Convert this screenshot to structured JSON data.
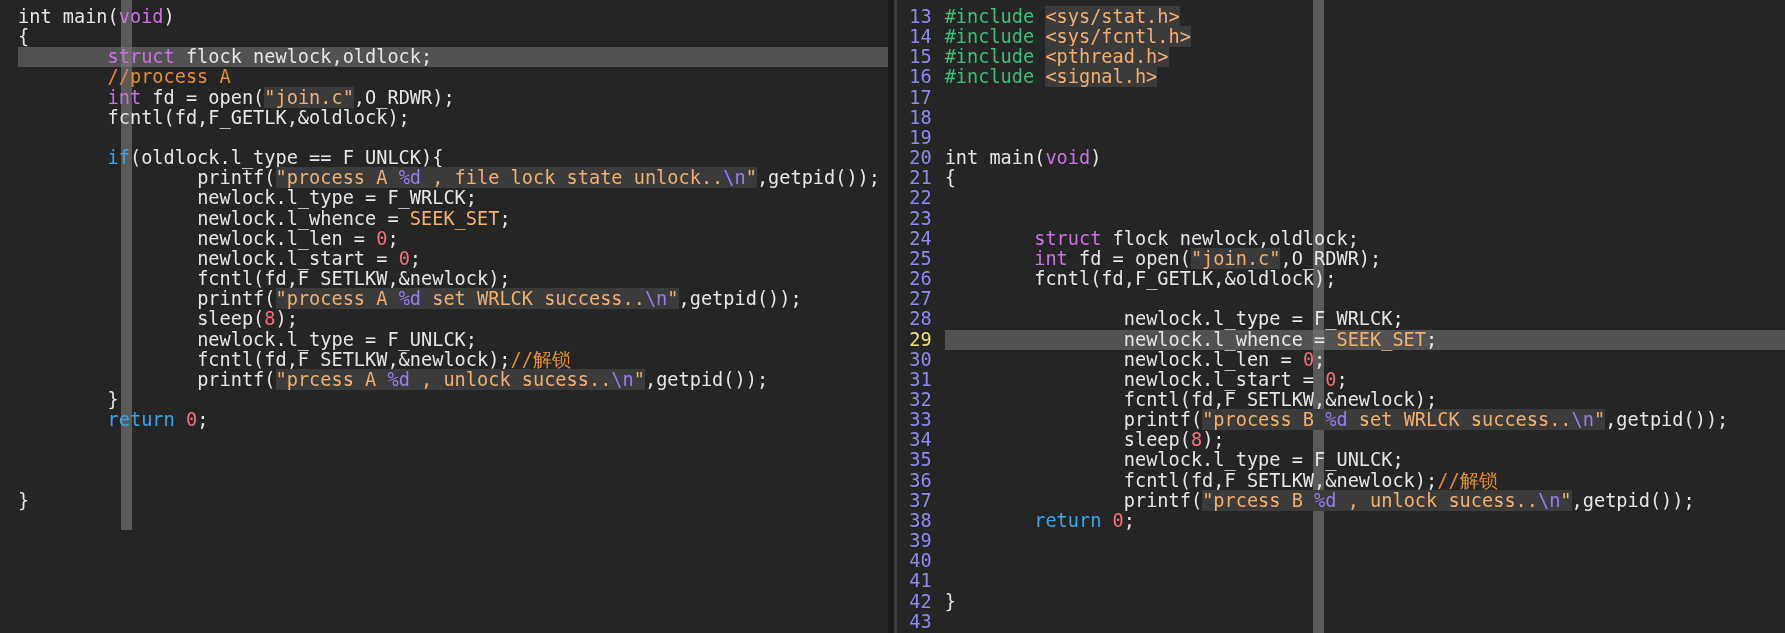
{
  "panes": [
    {
      "lines": [
        {
          "current": false,
          "tokens": [
            {
              "kind": "plain",
              "text": "int main("
            },
            {
              "kind": "type",
              "text": "void"
            },
            {
              "kind": "plain",
              "text": ")"
            }
          ]
        },
        {
          "current": false,
          "tokens": [
            {
              "kind": "plain",
              "text": "{"
            }
          ]
        },
        {
          "current": true,
          "tokens": [
            {
              "kind": "type",
              "text": "\tstruct"
            },
            {
              "kind": "plain",
              "text": " flock newlock,oldlock;"
            }
          ]
        },
        {
          "current": false,
          "tokens": [
            {
              "kind": "comment",
              "text": "\t//process A"
            }
          ]
        },
        {
          "current": false,
          "tokens": [
            {
              "kind": "type",
              "text": "\tint"
            },
            {
              "kind": "plain",
              "text": " fd = open("
            },
            {
              "kind": "string",
              "text": "\"join.c\""
            },
            {
              "kind": "plain",
              "text": ",O_RDWR);"
            }
          ]
        },
        {
          "current": false,
          "tokens": [
            {
              "kind": "plain",
              "text": "\tfcntl(fd,F_GETLK,&oldlock);"
            }
          ]
        },
        {
          "current": false
        },
        {
          "current": false,
          "tokens": [
            {
              "kind": "control",
              "text": "\tif"
            },
            {
              "kind": "plain",
              "text": "(oldlock.l_type == F_UNLCK){"
            }
          ]
        },
        {
          "current": false,
          "tokens": [
            {
              "kind": "plain",
              "text": "\t\tprintf("
            },
            {
              "kind": "string",
              "text": "\"process A "
            },
            {
              "kind": "format",
              "text": "%d"
            },
            {
              "kind": "string",
              "text": " , file lock state unlock.."
            },
            {
              "kind": "format",
              "text": "\\n"
            },
            {
              "kind": "string",
              "text": "\""
            },
            {
              "kind": "plain",
              "text": ",getpid());"
            }
          ]
        },
        {
          "current": false,
          "tokens": [
            {
              "kind": "plain",
              "text": "\t\tnewlock.l_type = F_WRLCK;"
            }
          ]
        },
        {
          "current": false,
          "tokens": [
            {
              "kind": "plain",
              "text": "\t\tnewlock.l_whence = "
            },
            {
              "kind": "constant",
              "text": "SEEK_SET"
            },
            {
              "kind": "plain",
              "text": ";"
            }
          ]
        },
        {
          "current": false,
          "tokens": [
            {
              "kind": "plain",
              "text": "\t\tnewlock.l_len = "
            },
            {
              "kind": "number",
              "text": "0"
            },
            {
              "kind": "plain",
              "text": ";"
            }
          ]
        },
        {
          "current": false,
          "tokens": [
            {
              "kind": "plain",
              "text": "\t\tnewlock.l_start = "
            },
            {
              "kind": "number",
              "text": "0"
            },
            {
              "kind": "plain",
              "text": ";"
            }
          ]
        },
        {
          "current": false,
          "tokens": [
            {
              "kind": "plain",
              "text": "\t\tfcntl(fd,F_SETLKW,&newlock);"
            }
          ]
        },
        {
          "current": false,
          "tokens": [
            {
              "kind": "plain",
              "text": "\t\tprintf("
            },
            {
              "kind": "string",
              "text": "\"process A "
            },
            {
              "kind": "format",
              "text": "%d"
            },
            {
              "kind": "string",
              "text": " set WRLCK success.."
            },
            {
              "kind": "format",
              "text": "\\n"
            },
            {
              "kind": "string",
              "text": "\""
            },
            {
              "kind": "plain",
              "text": ",getpid());"
            }
          ]
        },
        {
          "current": false,
          "tokens": [
            {
              "kind": "plain",
              "text": "\t\tsleep("
            },
            {
              "kind": "number",
              "text": "8"
            },
            {
              "kind": "plain",
              "text": ");"
            }
          ]
        },
        {
          "current": false,
          "tokens": [
            {
              "kind": "plain",
              "text": "\t\tnewlock.l_type = F_UNLCK;"
            }
          ]
        },
        {
          "current": false,
          "tokens": [
            {
              "kind": "plain",
              "text": "\t\tfcntl(fd,F_SETLKW,&newlock);"
            },
            {
              "kind": "comment",
              "text": "//解锁"
            }
          ]
        },
        {
          "current": false,
          "tokens": [
            {
              "kind": "plain",
              "text": "\t\tprintf("
            },
            {
              "kind": "string",
              "text": "\"prcess A "
            },
            {
              "kind": "format",
              "text": "%d"
            },
            {
              "kind": "string",
              "text": " , unlock sucess.."
            },
            {
              "kind": "format",
              "text": "\\n"
            },
            {
              "kind": "string",
              "text": "\""
            },
            {
              "kind": "plain",
              "text": ",getpid());"
            }
          ]
        },
        {
          "current": false,
          "tokens": [
            {
              "kind": "plain",
              "text": "\t}"
            }
          ]
        },
        {
          "current": false,
          "tokens": [
            {
              "kind": "control",
              "text": "\treturn"
            },
            {
              "kind": "number",
              "text": " 0"
            },
            {
              "kind": "plain",
              "text": ";"
            }
          ]
        },
        {
          "current": false
        },
        {
          "current": false
        },
        {
          "current": false
        },
        {
          "current": false,
          "tokens": [
            {
              "kind": "plain",
              "text": "}"
            }
          ]
        }
      ]
    },
    {
      "lines": [
        {
          "number": "13",
          "current": false,
          "tokens": [
            {
              "kind": "preproc",
              "text": "#include "
            },
            {
              "kind": "header",
              "text": "<sys/stat.h>"
            }
          ]
        },
        {
          "number": "14",
          "current": false,
          "tokens": [
            {
              "kind": "preproc",
              "text": "#include "
            },
            {
              "kind": "header",
              "text": "<sys/fcntl.h>"
            }
          ]
        },
        {
          "number": "15",
          "current": false,
          "tokens": [
            {
              "kind": "preproc",
              "text": "#include "
            },
            {
              "kind": "header",
              "text": "<pthread.h>"
            }
          ]
        },
        {
          "number": "16",
          "current": false,
          "tokens": [
            {
              "kind": "preproc",
              "text": "#include "
            },
            {
              "kind": "header",
              "text": "<signal.h>"
            }
          ]
        },
        {
          "number": "17",
          "current": false
        },
        {
          "number": "18",
          "current": false
        },
        {
          "number": "19",
          "current": false
        },
        {
          "number": "20",
          "current": false,
          "tokens": [
            {
              "kind": "plain",
              "text": "int main("
            },
            {
              "kind": "type",
              "text": "void"
            },
            {
              "kind": "plain",
              "text": ")"
            }
          ]
        },
        {
          "number": "21",
          "current": false,
          "tokens": [
            {
              "kind": "plain",
              "text": "{"
            }
          ]
        },
        {
          "number": "22",
          "current": false
        },
        {
          "number": "23",
          "current": false
        },
        {
          "number": "24",
          "current": false,
          "tokens": [
            {
              "kind": "type",
              "text": "\tstruct"
            },
            {
              "kind": "plain",
              "text": " flock newlock,oldlock;"
            }
          ]
        },
        {
          "number": "25",
          "current": false,
          "tokens": [
            {
              "kind": "type",
              "text": "\tint"
            },
            {
              "kind": "plain",
              "text": " fd = open("
            },
            {
              "kind": "string",
              "text": "\"join.c\""
            },
            {
              "kind": "plain",
              "text": ",O_RDWR);"
            }
          ]
        },
        {
          "number": "26",
          "current": false,
          "tokens": [
            {
              "kind": "plain",
              "text": "\tfcntl(fd,F_GETLK,&oldlock);"
            }
          ]
        },
        {
          "number": "27",
          "current": false
        },
        {
          "number": "28",
          "current": false,
          "tokens": [
            {
              "kind": "plain",
              "text": "\t\tnewlock.l_type = F_WRLCK;"
            }
          ]
        },
        {
          "number": "29",
          "current": true,
          "tokens": [
            {
              "kind": "plain",
              "text": "\t\tnewlock.l_whence = "
            },
            {
              "kind": "constant",
              "text": "SEEK_SET"
            },
            {
              "kind": "plain",
              "text": ";"
            }
          ]
        },
        {
          "number": "30",
          "current": false,
          "tokens": [
            {
              "kind": "plain",
              "text": "\t\tnewlock.l_len = "
            },
            {
              "kind": "number",
              "text": "0"
            },
            {
              "kind": "plain",
              "text": ";"
            }
          ]
        },
        {
          "number": "31",
          "current": false,
          "tokens": [
            {
              "kind": "plain",
              "text": "\t\tnewlock.l_start = "
            },
            {
              "kind": "number",
              "text": "0"
            },
            {
              "kind": "plain",
              "text": ";"
            }
          ]
        },
        {
          "number": "32",
          "current": false,
          "tokens": [
            {
              "kind": "plain",
              "text": "\t\tfcntl(fd,F_SETLKW,&newlock);"
            }
          ]
        },
        {
          "number": "33",
          "current": false,
          "tokens": [
            {
              "kind": "plain",
              "text": "\t\tprintf("
            },
            {
              "kind": "string",
              "text": "\"process B "
            },
            {
              "kind": "format",
              "text": "%d"
            },
            {
              "kind": "string",
              "text": " set WRLCK success.."
            },
            {
              "kind": "format",
              "text": "\\n"
            },
            {
              "kind": "string",
              "text": "\""
            },
            {
              "kind": "plain",
              "text": ",getpid());"
            }
          ]
        },
        {
          "number": "34",
          "current": false,
          "tokens": [
            {
              "kind": "plain",
              "text": "\t\tsleep("
            },
            {
              "kind": "number",
              "text": "8"
            },
            {
              "kind": "plain",
              "text": ");"
            }
          ]
        },
        {
          "number": "35",
          "current": false,
          "tokens": [
            {
              "kind": "plain",
              "text": "\t\tnewlock.l_type = F_UNLCK;"
            }
          ]
        },
        {
          "number": "36",
          "current": false,
          "tokens": [
            {
              "kind": "plain",
              "text": "\t\tfcntl(fd,F_SETLKW,&newlock);"
            },
            {
              "kind": "comment",
              "text": "//解锁"
            }
          ]
        },
        {
          "number": "37",
          "current": false,
          "tokens": [
            {
              "kind": "plain",
              "text": "\t\tprintf("
            },
            {
              "kind": "string",
              "text": "\"prcess B "
            },
            {
              "kind": "format",
              "text": "%d"
            },
            {
              "kind": "string",
              "text": " , unlock sucess.."
            },
            {
              "kind": "format",
              "text": "\\n"
            },
            {
              "kind": "string",
              "text": "\""
            },
            {
              "kind": "plain",
              "text": ",getpid());"
            }
          ]
        },
        {
          "number": "38",
          "current": false,
          "tokens": [
            {
              "kind": "control",
              "text": "\treturn"
            },
            {
              "kind": "number",
              "text": " 0"
            },
            {
              "kind": "plain",
              "text": ";"
            }
          ]
        },
        {
          "number": "39",
          "current": false
        },
        {
          "number": "40",
          "current": false
        },
        {
          "number": "41",
          "current": false
        },
        {
          "number": "42",
          "current": false,
          "tokens": [
            {
              "kind": "plain",
              "text": "}"
            }
          ]
        },
        {
          "number": "43",
          "current": false
        }
      ]
    }
  ]
}
